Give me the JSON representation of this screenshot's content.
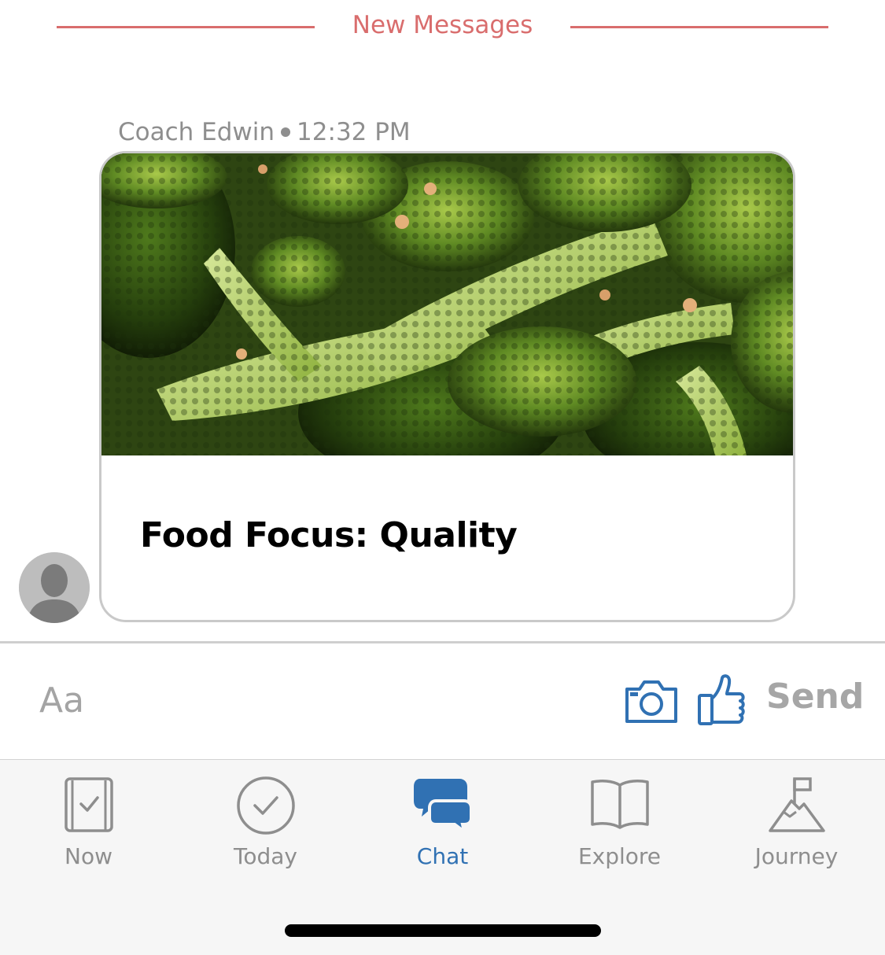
{
  "divider": {
    "label": "New Messages",
    "color": "#d96d6d"
  },
  "message": {
    "sender": "Coach Edwin",
    "time": "12:32 PM",
    "card_title": "Food Focus: Quality",
    "image_alt": "broccoli-photo"
  },
  "composer": {
    "placeholder": "Aa",
    "send_label": "Send",
    "camera_icon": "camera-icon",
    "thumb_icon": "thumbs-up-icon",
    "icon_color": "#3071b3"
  },
  "tabbar": {
    "active_color": "#3071b3",
    "inactive_color": "#8e8e8e",
    "tabs": [
      {
        "label": "Now",
        "icon": "journal-check-icon",
        "active": false
      },
      {
        "label": "Today",
        "icon": "check-circle-icon",
        "active": false
      },
      {
        "label": "Chat",
        "icon": "chat-bubbles-icon",
        "active": true
      },
      {
        "label": "Explore",
        "icon": "open-book-icon",
        "active": false
      },
      {
        "label": "Journey",
        "icon": "mountain-flag-icon",
        "active": false
      }
    ]
  }
}
